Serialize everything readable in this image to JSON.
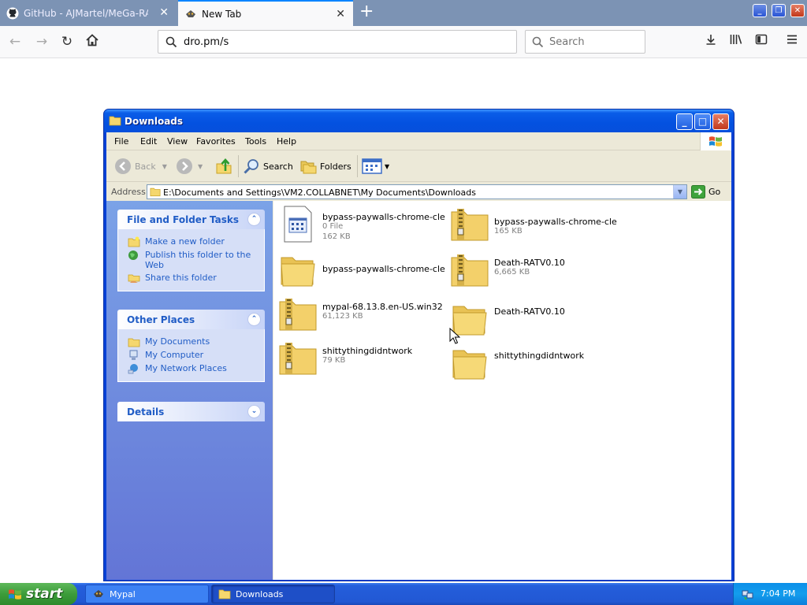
{
  "browser": {
    "tabs": [
      {
        "title": "GitHub - AJMartel/MeGa-RAT-Pac",
        "close": "✕"
      },
      {
        "title": "New Tab",
        "close": "✕"
      }
    ],
    "new_tab": "+",
    "url": "dro.pm/s",
    "search_placeholder": "Search",
    "window_controls": [
      "_",
      "❐",
      "✕"
    ]
  },
  "explorer": {
    "title": "Downloads",
    "title_buttons": [
      "_",
      "□",
      "✕"
    ],
    "menu": [
      "File",
      "Edit",
      "View",
      "Favorites",
      "Tools",
      "Help"
    ],
    "toolbar": {
      "back": "Back",
      "search": "Search",
      "folders": "Folders"
    },
    "address_label": "Address",
    "address_path": "E:\\Documents and Settings\\VM2.COLLABNET\\My Documents\\Downloads",
    "go_label": "Go",
    "task_panels": [
      {
        "title": "File and Folder Tasks",
        "links": [
          "Make a new folder",
          "Publish this folder to the Web",
          "Share this folder"
        ]
      },
      {
        "title": "Other Places",
        "links": [
          "My Documents",
          "My Computer",
          "My Network Places"
        ]
      },
      {
        "title": "Details",
        "links": []
      }
    ],
    "files": [
      {
        "name": "bypass-paywalls-chrome-clea...",
        "type": "0 File",
        "size": "162 KB",
        "icon": "generic-file-icon"
      },
      {
        "name": "bypass-paywalls-chrome-clea...",
        "type": "",
        "size": "165 KB",
        "icon": "zip-folder-icon"
      },
      {
        "name": "bypass-paywalls-chrome-clea...",
        "type": "",
        "size": "",
        "icon": "folder-icon"
      },
      {
        "name": "Death-RATV0.10",
        "type": "",
        "size": "6,665 KB",
        "icon": "zip-folder-icon"
      },
      {
        "name": "mypal-68.13.8.en-US.win32",
        "type": "",
        "size": "61,123 KB",
        "icon": "zip-folder-icon"
      },
      {
        "name": "Death-RATV0.10",
        "type": "",
        "size": "",
        "icon": "folder-icon"
      },
      {
        "name": "shittythingdidntwork",
        "type": "",
        "size": "79 KB",
        "icon": "zip-folder-icon"
      },
      {
        "name": "shittythingdidntwork",
        "type": "",
        "size": "",
        "icon": "folder-icon"
      }
    ]
  },
  "taskbar": {
    "start_label": "start",
    "tasks": [
      "Mypal",
      "Downloads"
    ],
    "clock": "7:04 PM"
  },
  "colors": {
    "xp_blue": "#0841d6",
    "link": "#215dc6",
    "taskbar": "#245edb"
  }
}
